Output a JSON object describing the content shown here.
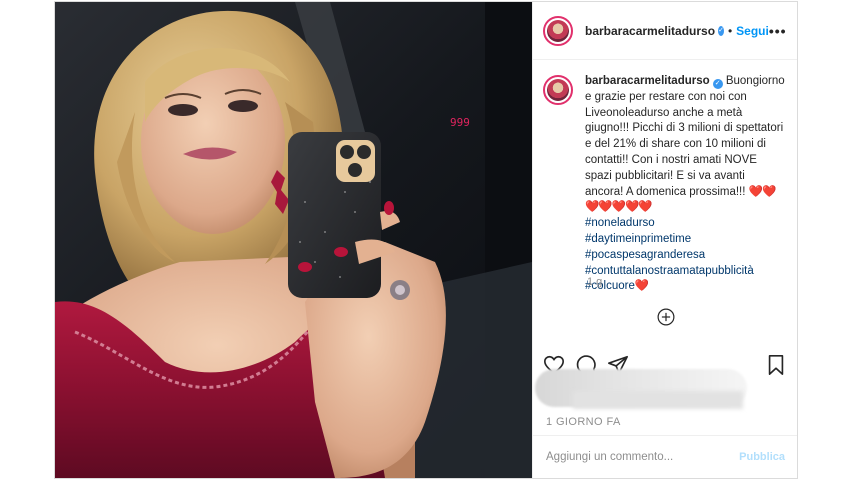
{
  "header": {
    "username": "barbaracarmelitadurso",
    "separator": "•",
    "follow_label": "Segui",
    "more_label": "•••"
  },
  "caption": {
    "username": "barbaracarmelitadurso",
    "text": "Buongiorno e grazie per restare con noi con Liveonoleadurso anche a metà giugno!!! Picchi di 3 milioni di spettatori e del 21% di share con 10 milioni di contatti!! Con i nostri amati NOVE spazi pubblicitari! E si va avanti ancora! A domenica prossima!!!",
    "hearts": "❤️❤️❤️❤️❤️❤️❤️",
    "hashtags": [
      "#noneladurso",
      "#daytimeinprimetime",
      "#pocaspesagranderesa",
      "#contuttalanostraamatapubblicità",
      "#colcuore"
    ],
    "last_tag_emoji": "❤️",
    "time_ago": "1 g"
  },
  "footer": {
    "date": "1 GIORNO FA",
    "comment_placeholder": "Aggiungi un commento...",
    "publish_label": "Pubblica"
  },
  "icons": {
    "heart": "heart-icon",
    "comment": "comment-icon",
    "share": "share-icon",
    "save": "bookmark-icon",
    "add": "add-circle-icon",
    "verified": "verified-badge-icon"
  },
  "colors": {
    "follow": "#0095f6",
    "hashtag": "#00376b",
    "verified": "#3897f0",
    "publish_disabled": "#b2dffc"
  }
}
